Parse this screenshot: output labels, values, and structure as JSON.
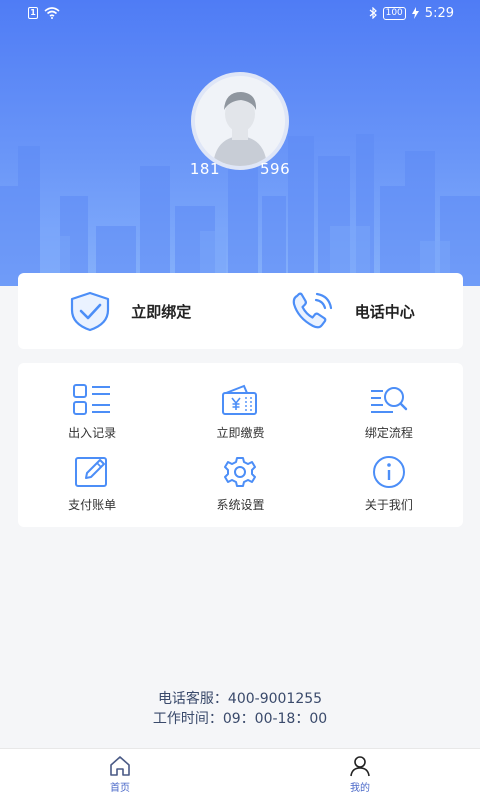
{
  "status_bar": {
    "sim_label": "1",
    "battery_level": "100",
    "time": "5:29"
  },
  "profile": {
    "phone_masked": "181     596"
  },
  "quick_actions": [
    {
      "label": "立即绑定",
      "icon": "shield-check-icon"
    },
    {
      "label": "电话中心",
      "icon": "phone-call-icon"
    }
  ],
  "menu": [
    {
      "label": "出入记录",
      "icon": "list-grid-icon"
    },
    {
      "label": "立即缴费",
      "icon": "wallet-yen-icon"
    },
    {
      "label": "绑定流程",
      "icon": "search-list-icon"
    },
    {
      "label": "支付账单",
      "icon": "edit-icon"
    },
    {
      "label": "系统设置",
      "icon": "gear-icon"
    },
    {
      "label": "关于我们",
      "icon": "info-icon"
    }
  ],
  "service": {
    "phone_line": "电话客服：400-9001255",
    "hours_line": "工作时间：09：00-18：00"
  },
  "tabbar": {
    "home_label": "首页",
    "mine_label": "我的"
  },
  "colors": {
    "accent": "#4f7cf5",
    "icon_blue": "#4c8ef7",
    "tab_active": "#4a68c8",
    "tab_inactive": "#4a68c8"
  }
}
